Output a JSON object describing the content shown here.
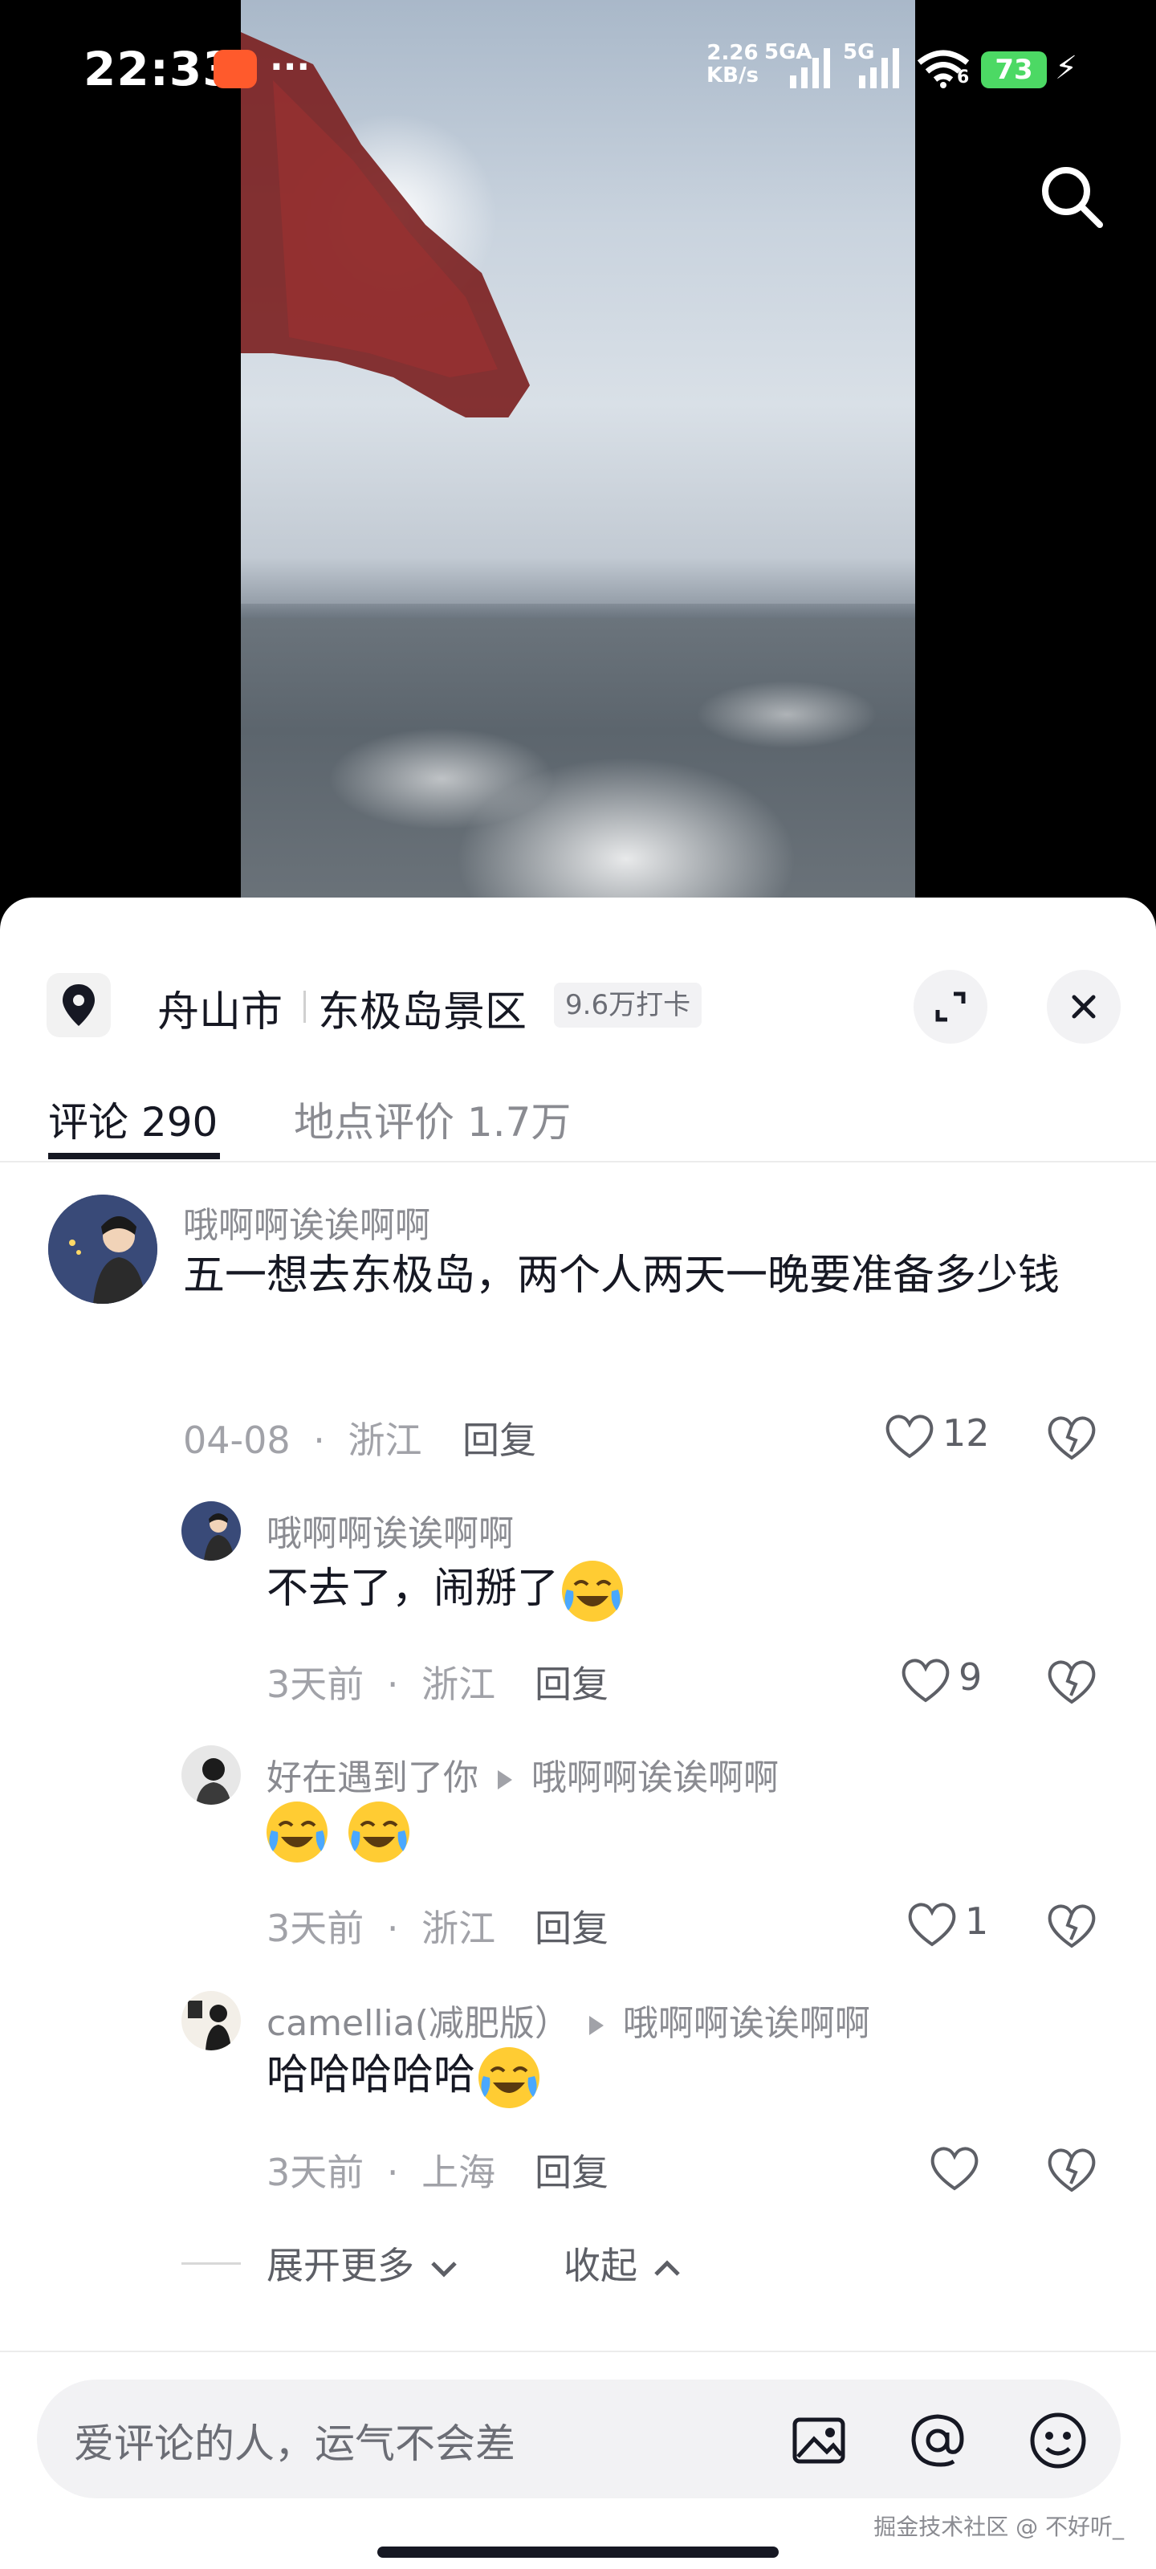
{
  "status_bar": {
    "time": "22:33",
    "net_speed_value": "2.26",
    "net_speed_unit": "KB/s",
    "sim1_label": "5GA",
    "sim2_label": "5G",
    "wifi_label": "6",
    "battery": "73",
    "overflow": "···"
  },
  "location": {
    "city": "舟山市",
    "spot": "东极岛景区",
    "checkins": "9.6万打卡"
  },
  "tabs": [
    {
      "label": "评论 290",
      "active": true
    },
    {
      "label": "地点评价 1.7万",
      "active": false
    }
  ],
  "comments": [
    {
      "user": "哦啊啊诶诶啊啊",
      "text": "五一想去东极岛，两个人两天一晚要准备多少钱",
      "date": "04-08",
      "region": "浙江",
      "reply_label": "回复",
      "likes": "12"
    }
  ],
  "replies": [
    {
      "user": "哦啊啊诶诶啊啊",
      "reply_to": "",
      "text": "不去了，闹掰了",
      "date": "3天前",
      "region": "浙江",
      "reply_label": "回复",
      "likes": "9"
    },
    {
      "user": "好在遇到了你",
      "reply_to": "哦啊啊诶诶啊啊",
      "text": "",
      "date": "3天前",
      "region": "浙江",
      "reply_label": "回复",
      "likes": "1"
    },
    {
      "user": "camellia(减肥版）",
      "reply_to": "哦啊啊诶诶啊啊",
      "text": "哈哈哈哈哈",
      "date": "3天前",
      "region": "上海",
      "reply_label": "回复",
      "likes": ""
    }
  ],
  "thread_controls": {
    "expand": "展开更多",
    "collapse": "收起"
  },
  "input": {
    "placeholder": "爱评论的人，运气不会差"
  },
  "meta_sep": "·",
  "watermark": "掘金技术社区 @ 不好听_",
  "icons": [
    "search-icon",
    "location-pin-icon",
    "expand-icon",
    "close-icon",
    "heart-icon",
    "dislike-icon",
    "image-icon",
    "at-icon",
    "emoji-icon",
    "chevron-down-icon",
    "chevron-up-icon"
  ]
}
